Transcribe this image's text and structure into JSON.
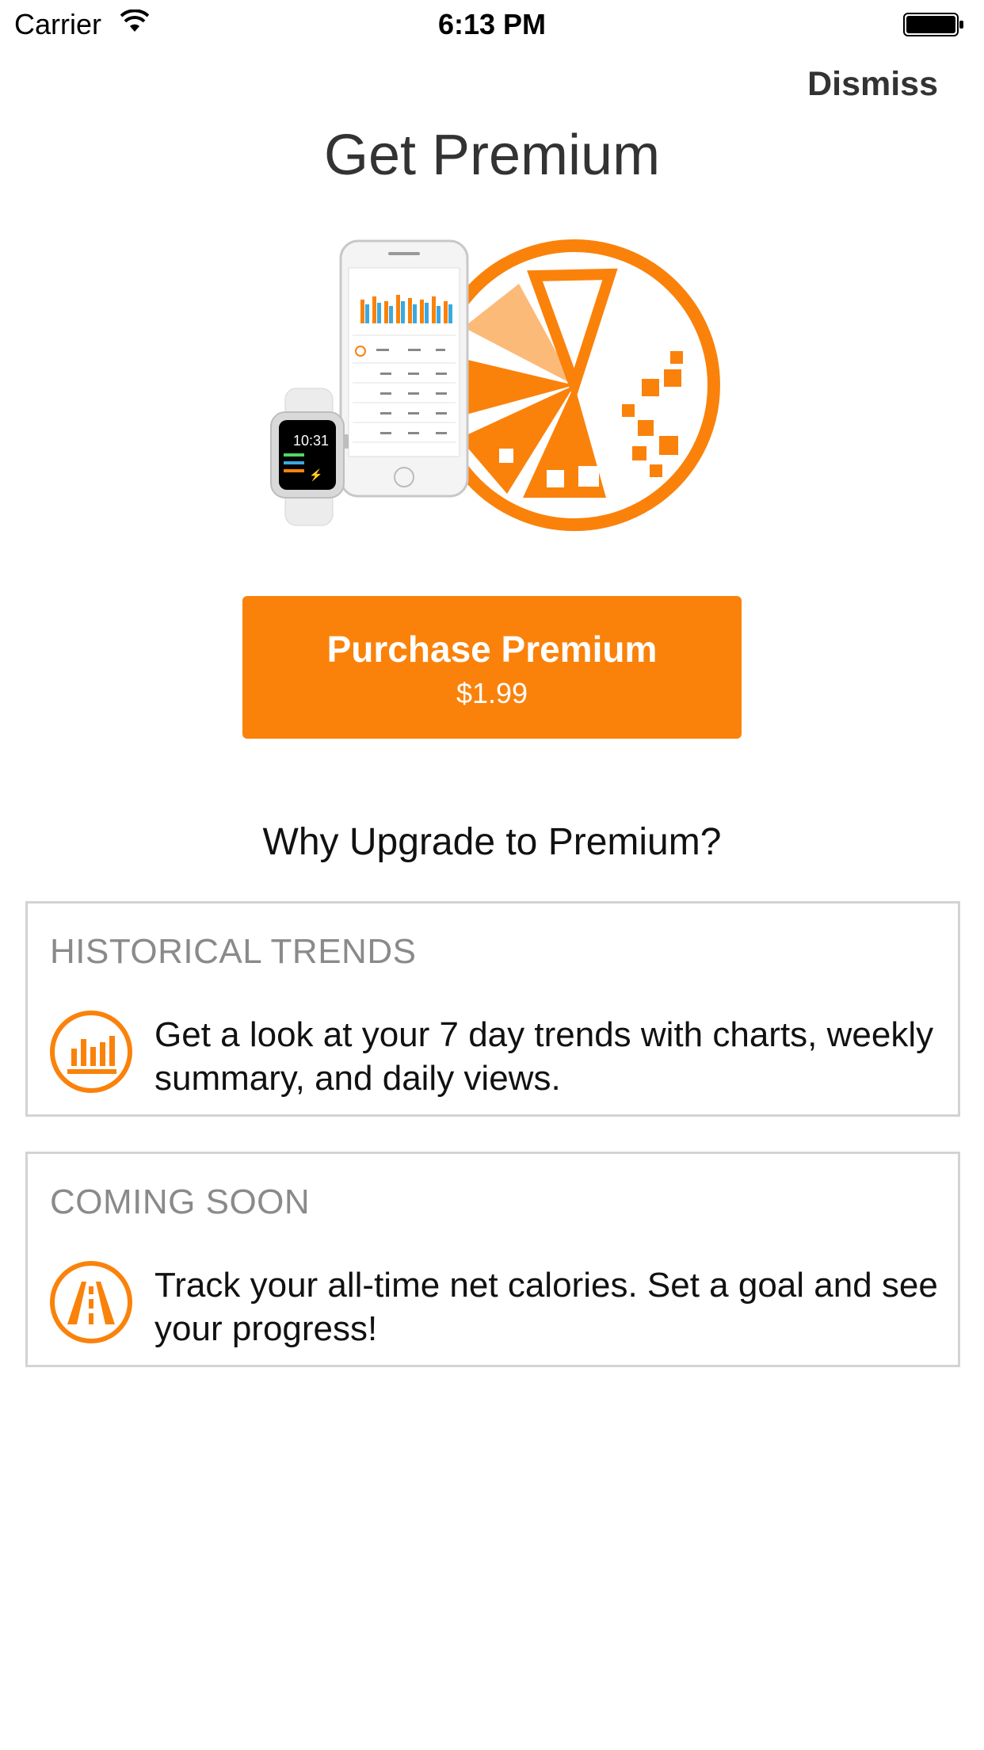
{
  "status_bar": {
    "carrier": "Carrier",
    "time": "6:13 PM"
  },
  "nav": {
    "dismiss_label": "Dismiss"
  },
  "header": {
    "title": "Get Premium"
  },
  "hero": {
    "watch_time": "10:31",
    "icons": [
      "apple-watch",
      "iphone",
      "orange-slice-logo"
    ]
  },
  "purchase": {
    "label": "Purchase Premium",
    "price": "$1.99"
  },
  "why": {
    "heading": "Why Upgrade to Premium?"
  },
  "features": [
    {
      "header": "HISTORICAL TRENDS",
      "icon": "bar-chart-icon",
      "text": "Get a look at your 7 day trends with charts, weekly summary, and daily views."
    },
    {
      "header": "COMING SOON",
      "icon": "road-icon",
      "text": "Track your all-time net calories. Set a goal and see your progress!"
    }
  ],
  "colors": {
    "accent": "#fa820b",
    "title_text": "#333333",
    "card_header": "#8a8a8a",
    "card_border": "#d3d3d3"
  }
}
